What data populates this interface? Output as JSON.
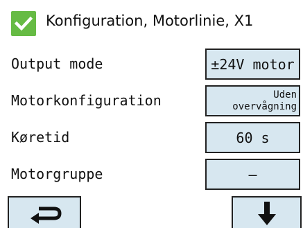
{
  "header": {
    "title": "Konfiguration, Motorlinie, X1",
    "checkbox_checked": true,
    "check_color": "#66bb44"
  },
  "rows": [
    {
      "label": "Output mode",
      "value": "±24V motor"
    },
    {
      "label": "Motorkonfiguration",
      "value_line1": "Uden",
      "value_line2": "overvågning"
    },
    {
      "label": "Køretid",
      "value": "60 s"
    },
    {
      "label": "Motorgruppe",
      "value": "–"
    }
  ],
  "nav": {
    "back_icon": "return-arrow-icon",
    "down_icon": "arrow-down-icon"
  },
  "colors": {
    "button_bg": "#d7e7f0",
    "button_border": "#222222",
    "accent_green": "#66bb44"
  }
}
